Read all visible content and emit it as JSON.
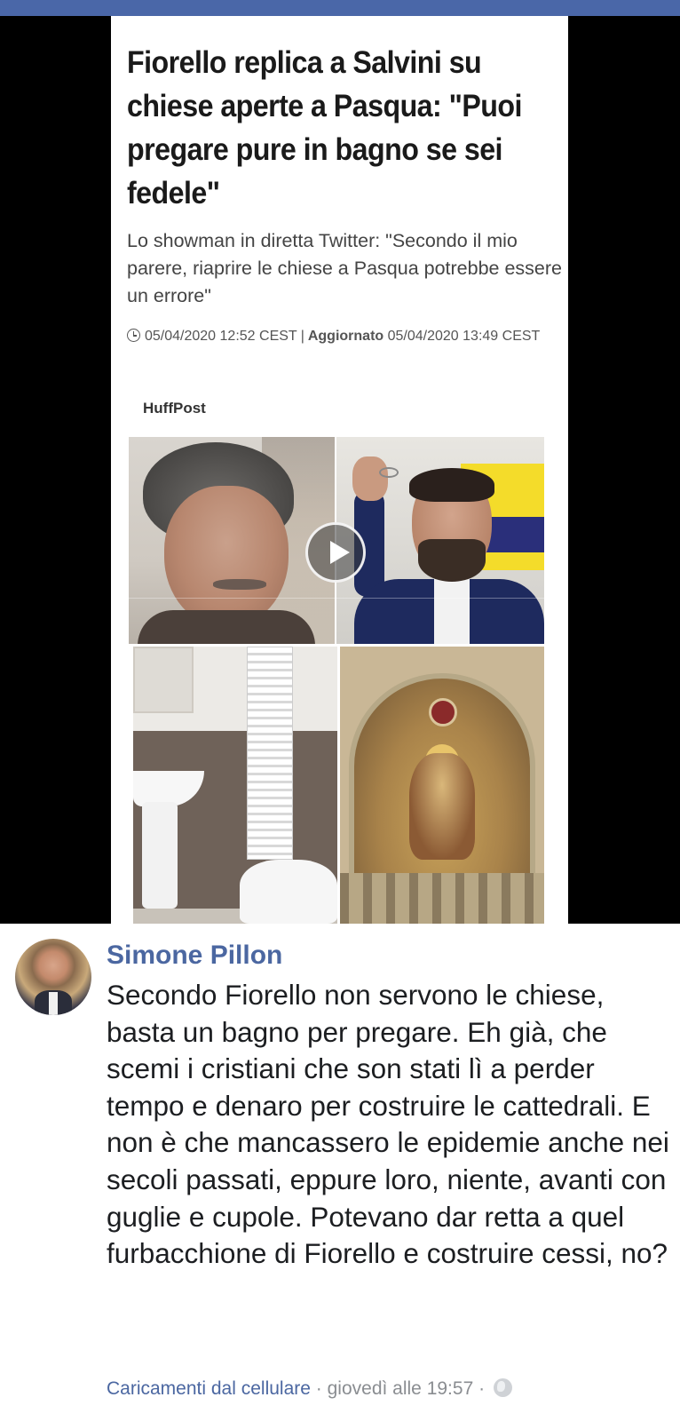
{
  "article": {
    "headline": "Fiorello replica a Salvini su chiese aperte a Pasqua: \"Puoi pregare pure in bagno se sei fedele\"",
    "subtitle": "Lo showman in diretta Twitter: \"Secondo il mio parere, riaprire le chiese a Pasqua potrebbe essere un errore\"",
    "published": "05/04/2020 12:52 CEST",
    "separator": "|",
    "updated_label": "Aggiornato",
    "updated": "05/04/2020 13:49 CEST",
    "source": "HuffPost"
  },
  "post": {
    "author": "Simone Pillon",
    "text": "Secondo Fiorello non servono le chiese, basta un bagno per pregare. Eh già, che scemi i cristiani che son stati lì a perder tempo e denaro per costruire le cattedrali. E non è che mancassero le epidemie anche nei secoli passati, eppure loro, niente, avanti con guglie e cupole. Potevano dar retta a quel furbacchione di Fiorello e costruire cessi, no?",
    "upload_source": "Caricamenti dal cellulare",
    "separator": "·",
    "timestamp": "giovedì alle 19:57",
    "privacy_icon": "globe-icon"
  },
  "colors": {
    "top_bar": "#4a67a8",
    "author": "#4b67a1",
    "footer_text": "#8a8d91"
  }
}
